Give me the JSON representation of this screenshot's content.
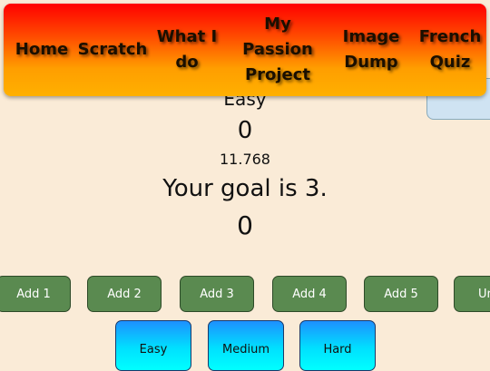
{
  "nav": {
    "items": [
      {
        "label": "Home"
      },
      {
        "label": "Scratch"
      },
      {
        "label": "What I do"
      },
      {
        "label": "My Passion Project"
      },
      {
        "label": "Image Dump"
      },
      {
        "label": "French Quiz"
      }
    ]
  },
  "game": {
    "mode": "Easy",
    "score_top": "0",
    "timer": "11.768",
    "goal_text": "Your goal is 3.",
    "score_bottom": "0"
  },
  "add_buttons": [
    "Add 1",
    "Add 2",
    "Add 3",
    "Add 4",
    "Add 5",
    "Un"
  ],
  "difficulty_buttons": [
    "Easy",
    "Medium",
    "Hard"
  ],
  "colors": {
    "background": "#faebd7",
    "nav_gradient_top": "#ff0000",
    "nav_gradient_bottom": "#ffb000",
    "add_button": "#5a8a50",
    "difficulty_gradient_top": "#1e90ff",
    "difficulty_gradient_bottom": "#00ffff"
  }
}
